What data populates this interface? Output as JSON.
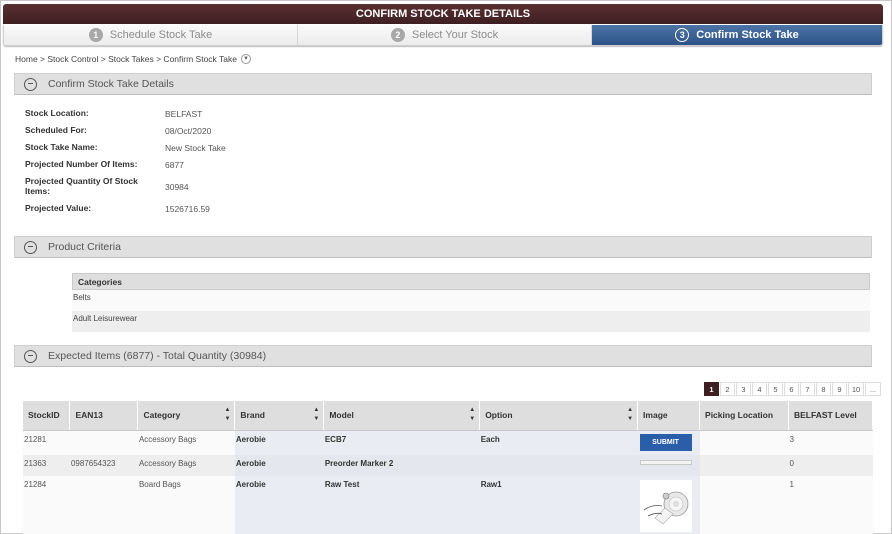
{
  "header": {
    "title": "CONFIRM STOCK TAKE DETAILS"
  },
  "steps": [
    {
      "number": "1",
      "label": "Schedule Stock Take",
      "active": false
    },
    {
      "number": "2",
      "label": "Select Your Stock",
      "active": false
    },
    {
      "number": "3",
      "label": "Confirm Stock Take",
      "active": true
    }
  ],
  "breadcrumb": {
    "text": "Home > Stock Control > Stock Takes > Confirm Stock Take",
    "dropdown_icon": "chevron-down-icon"
  },
  "sections": {
    "details": {
      "title": "Confirm Stock Take Details",
      "rows": [
        {
          "label": "Stock Location:",
          "value": "BELFAST"
        },
        {
          "label": "Scheduled For:",
          "value": "08/Oct/2020"
        },
        {
          "label": "Stock Take Name:",
          "value": "New Stock Take"
        },
        {
          "label": "Projected Number Of Items:",
          "value": "6877"
        },
        {
          "label": "Projected Quantity Of Stock Items:",
          "value": "30984"
        },
        {
          "label": "Projected Value:",
          "value": "1526716.59"
        }
      ]
    },
    "criteria": {
      "title": "Product Criteria",
      "table_header": "Categories",
      "categories": [
        "Belts",
        "Adult Leisurewear"
      ]
    },
    "expected": {
      "title": "Expected Items (6877) - Total Quantity (30984)",
      "pagination": [
        "1",
        "2",
        "3",
        "4",
        "5",
        "6",
        "7",
        "8",
        "9",
        "10",
        "..."
      ],
      "current_page": "1",
      "columns": [
        "StockID",
        "EAN13",
        "Category",
        "Brand",
        "Model",
        "Option",
        "Image",
        "Picking Location",
        "BELFAST Level"
      ],
      "rows": [
        {
          "stock_id": "21281",
          "ean13": "",
          "category": "Accessory Bags",
          "brand": "Aerobie",
          "model": "ECB7",
          "option": "Each",
          "image": "submit-button",
          "picking_location": "",
          "level": "3"
        },
        {
          "stock_id": "21363",
          "ean13": "0987654323",
          "category": "Accessory Bags",
          "brand": "Aerobie",
          "model": "Preorder Marker 2",
          "option": "",
          "image": "empty",
          "picking_location": "",
          "level": "0"
        },
        {
          "stock_id": "21284",
          "ean13": "",
          "category": "Board Bags",
          "brand": "Aerobie",
          "model": "Raw Test",
          "option": "Raw1",
          "image": "product-thumbnail",
          "picking_location": "",
          "level": "1"
        }
      ],
      "submit_label": "SUBMIT"
    }
  }
}
